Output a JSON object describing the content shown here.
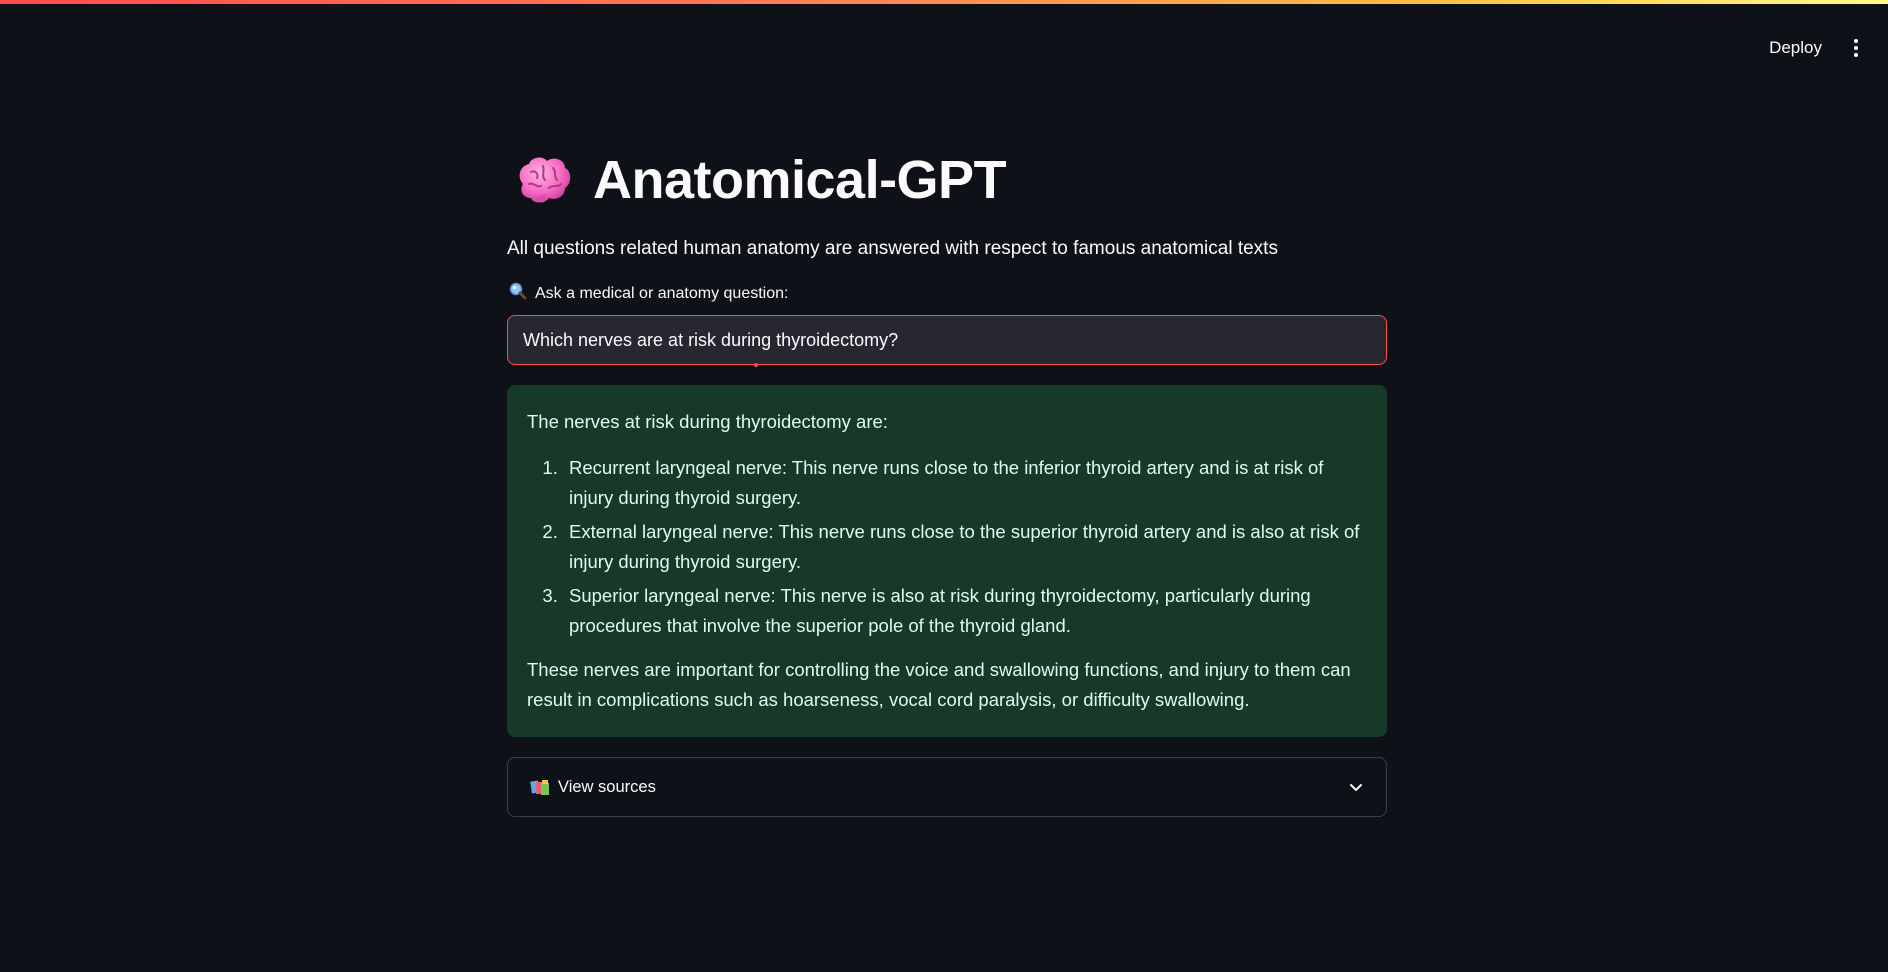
{
  "header": {
    "deploy_label": "Deploy",
    "menu_icon": "kebab-menu-icon"
  },
  "main": {
    "title": "Anatomical-GPT",
    "title_icon": "brain-icon",
    "subtitle": "All questions related human anatomy are answered with respect to famous anatomical texts",
    "question": {
      "label": "Ask a medical or anatomy question:",
      "label_icon": "magnifying-glass-icon",
      "value": "Which nerves are at risk during thyroidectomy?"
    },
    "answer": {
      "intro": "The nerves at risk during thyroidectomy are:",
      "items": [
        "Recurrent laryngeal nerve: This nerve runs close to the inferior thyroid artery and is at risk of injury during thyroid surgery.",
        "External laryngeal nerve: This nerve runs close to the superior thyroid artery and is also at risk of injury during thyroid surgery.",
        "Superior laryngeal nerve: This nerve is also at risk during thyroidectomy, particularly during procedures that involve the superior pole of the thyroid gland."
      ],
      "conclusion": "These nerves are important for controlling the voice and swallowing functions, and injury to them can result in complications such as hoarseness, vocal cord paralysis, or difficulty swallowing."
    },
    "sources": {
      "label": "View sources",
      "icon": "books-icon",
      "chevron_icon": "chevron-down-icon"
    }
  },
  "colors": {
    "background": "#0e1117",
    "accent": "#ff4b4b",
    "input_bg": "#262730",
    "success_bg": "#173928",
    "success_text": "#dffde9"
  }
}
